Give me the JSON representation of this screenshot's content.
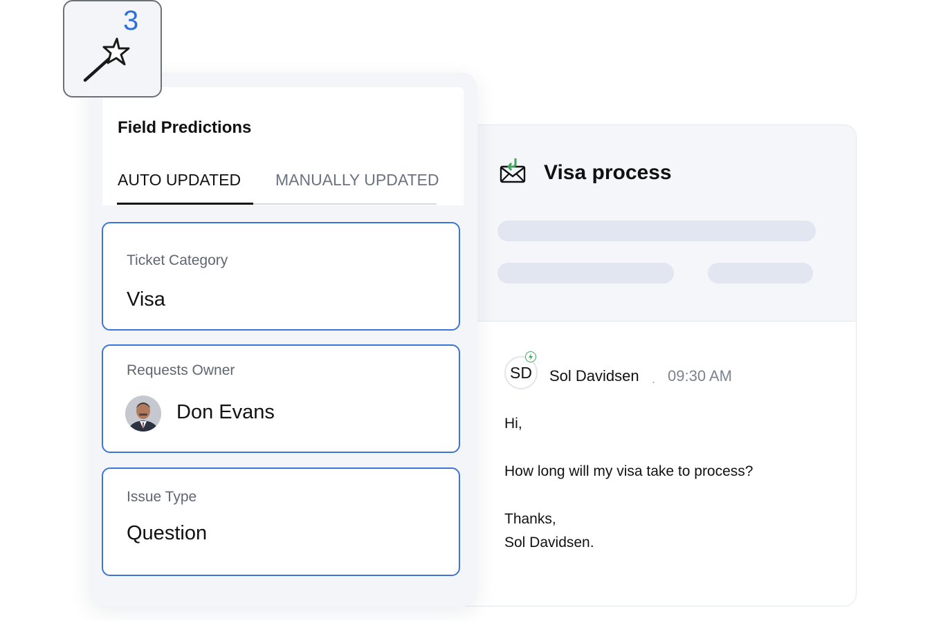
{
  "wand_badge": {
    "count": "3",
    "icon": "magic-wand-icon"
  },
  "predictions": {
    "title": "Field Predictions",
    "tabs": [
      {
        "label": "AUTO UPDATED",
        "active": true
      },
      {
        "label": "MANUALLY UPDATED",
        "active": false
      }
    ],
    "fields": [
      {
        "label": "Ticket Category",
        "value": "Visa"
      },
      {
        "label": "Requests Owner",
        "value": "Don Evans",
        "avatar": "user-photo"
      },
      {
        "label": "Issue Type",
        "value": "Question"
      }
    ]
  },
  "ticket": {
    "icon": "incoming-mail-icon",
    "title": "Visa process",
    "message": {
      "avatar_initials": "SD",
      "sender": "Sol Davidsen",
      "separator": ".",
      "time": "09:30 AM",
      "lines": [
        "Hi,",
        "How long will my visa take to process?",
        "Thanks,",
        "Sol Davidsen."
      ]
    }
  },
  "colors": {
    "accent": "#3b73d6",
    "badge_green": "#3ca65a",
    "panel_bg": "#f3f5f9"
  }
}
